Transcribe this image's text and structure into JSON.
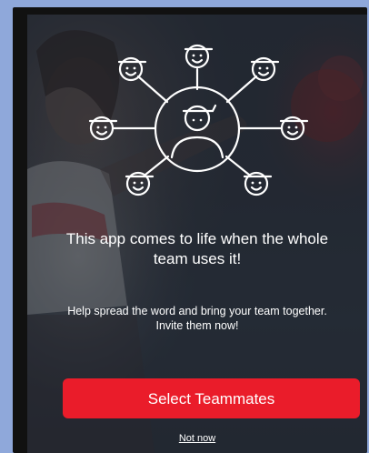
{
  "headline": "This app comes to life when the whole team uses it!",
  "subtext": "Help spread the word and bring your team together. Invite them now!",
  "cta_label": "Select Teammates",
  "skip_label": "Not now",
  "colors": {
    "cta": "#ea1c2a",
    "frame": "#8fa8da",
    "screen_bg": "#2c313b"
  },
  "illustration": {
    "center_icon": "team-member-icon",
    "satellite_icon": "smiley-face-icon",
    "satellite_count": 8
  }
}
